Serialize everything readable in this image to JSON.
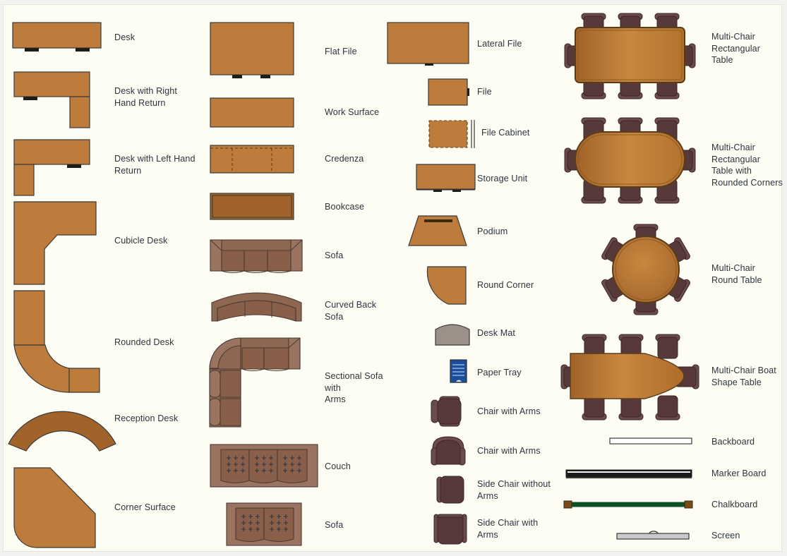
{
  "stencil": {
    "title": "Office Furniture Stencil",
    "background_color": "#fdfdf3",
    "label_color": "#2c3440",
    "accent_wood": "#bd7b3c",
    "accent_wood_dark": "#a1632a",
    "accent_sofa": "#8e6753",
    "accent_chair": "#57393a",
    "accent_paper_tray": "#1b4f9b",
    "accent_desk_mat": "#9b9189",
    "accent_chalkboard": "#0b5025"
  },
  "columns": [
    {
      "name": "desks",
      "items": [
        {
          "label": "Desk",
          "icon": "desk-shape"
        },
        {
          "label": "Desk with Right\nHand Return",
          "icon": "desk-right-return-shape"
        },
        {
          "label": "Desk with Left Hand\nReturn",
          "icon": "desk-left-return-shape"
        },
        {
          "label": "Cubicle Desk",
          "icon": "cubicle-desk-shape"
        },
        {
          "label": "Rounded Desk",
          "icon": "rounded-desk-shape"
        },
        {
          "label": "Reception Desk",
          "icon": "reception-desk-shape"
        },
        {
          "label": "Corner Surface",
          "icon": "corner-surface-shape"
        }
      ]
    },
    {
      "name": "surfaces-and-sofas",
      "items": [
        {
          "label": "Flat File",
          "icon": "flat-file-shape"
        },
        {
          "label": "Work Surface",
          "icon": "work-surface-shape"
        },
        {
          "label": "Credenza",
          "icon": "credenza-shape"
        },
        {
          "label": "Bookcase",
          "icon": "bookcase-shape"
        },
        {
          "label": "Sofa",
          "icon": "sofa-shape"
        },
        {
          "label": "Curved Back Sofa",
          "icon": "curved-back-sofa-shape"
        },
        {
          "label": "Sectional Sofa with\nArms",
          "icon": "sectional-sofa-shape"
        },
        {
          "label": "Couch",
          "icon": "couch-shape"
        },
        {
          "label": "Sofa",
          "icon": "sofa-cushion-shape"
        }
      ]
    },
    {
      "name": "files-and-chairs",
      "items": [
        {
          "label": "Lateral File",
          "icon": "lateral-file-shape"
        },
        {
          "label": "File",
          "icon": "file-shape"
        },
        {
          "label": "File Cabinet",
          "icon": "file-cabinet-shape"
        },
        {
          "label": "Storage Unit",
          "icon": "storage-unit-shape"
        },
        {
          "label": "Podium",
          "icon": "podium-shape"
        },
        {
          "label": "Round Corner",
          "icon": "round-corner-shape"
        },
        {
          "label": "Desk Mat",
          "icon": "desk-mat-shape"
        },
        {
          "label": "Paper Tray",
          "icon": "paper-tray-shape"
        },
        {
          "label": "Chair with Arms",
          "icon": "chair-with-arms-shape"
        },
        {
          "label": "Chair with Arms",
          "icon": "chair-with-arms-alt-shape"
        },
        {
          "label": "Side Chair without\nArms",
          "icon": "side-chair-without-arms-shape"
        },
        {
          "label": "Side Chair with\nArms",
          "icon": "side-chair-with-arms-shape"
        }
      ]
    },
    {
      "name": "conference-tables-and-boards",
      "items": [
        {
          "label": "Multi-Chair\nRectangular\nTable",
          "icon": "multi-chair-rectangular-table-shape"
        },
        {
          "label": "Multi-Chair\nRectangular\nTable with\nRounded Corners",
          "icon": "multi-chair-rounded-rect-table-shape"
        },
        {
          "label": "Multi-Chair\nRound Table",
          "icon": "multi-chair-round-table-shape"
        },
        {
          "label": "Multi-Chair Boat\nShape Table",
          "icon": "multi-chair-boat-table-shape"
        },
        {
          "label": "Backboard",
          "icon": "backboard-shape"
        },
        {
          "label": "Marker Board",
          "icon": "marker-board-shape"
        },
        {
          "label": "Chalkboard",
          "icon": "chalkboard-shape"
        },
        {
          "label": "Screen",
          "icon": "screen-shape"
        }
      ]
    }
  ]
}
